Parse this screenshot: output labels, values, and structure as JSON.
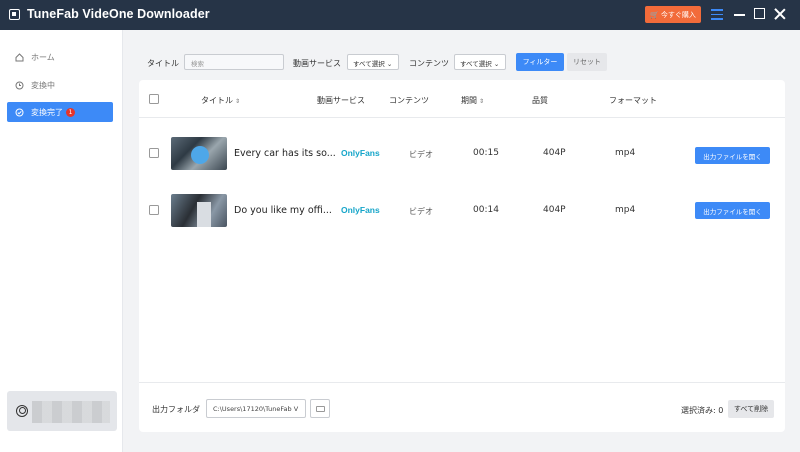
{
  "app": {
    "title": "TuneFab VideOne Downloader",
    "buy_label": "今すぐ購入",
    "buy_icon": "cart-icon",
    "accent_color": "#3d8af7",
    "buy_color": "#f26b3a",
    "titlebar_color": "#263447"
  },
  "sidebar": {
    "items": [
      {
        "label": "ホーム",
        "icon": "home-icon"
      },
      {
        "label": "変換中",
        "icon": "clock-icon"
      },
      {
        "label": "変換完了",
        "icon": "check-circle-icon",
        "badge": "1"
      }
    ]
  },
  "filters": {
    "title_label": "タイトル",
    "search_placeholder": "検索",
    "service_label": "動画サービス",
    "service_value": "すべて選択",
    "content_label": "コンテンツ",
    "content_value": "すべて選択",
    "filter_button": "フィルター",
    "reset_button": "リセット"
  },
  "table": {
    "headers": {
      "title": "タイトル",
      "service": "動画サービス",
      "content": "コンテンツ",
      "duration": "期間",
      "quality": "品質",
      "format": "フォーマット"
    },
    "rows": [
      {
        "title": "Every car has its so...",
        "service": "OnlyFans",
        "content": "ビデオ",
        "duration": "00:15",
        "quality": "404P",
        "format": "mp4",
        "action": "出力ファイルを開く"
      },
      {
        "title": "Do you like my offi...",
        "service": "OnlyFans",
        "content": "ビデオ",
        "duration": "00:14",
        "quality": "404P",
        "format": "mp4",
        "action": "出力ファイルを開く"
      }
    ]
  },
  "footer": {
    "output_label": "出力フォルダ",
    "output_path": "C:\\Users\\17120\\TuneFab V",
    "selected_label": "選択済み: 0",
    "delete_all": "すべて削除"
  }
}
